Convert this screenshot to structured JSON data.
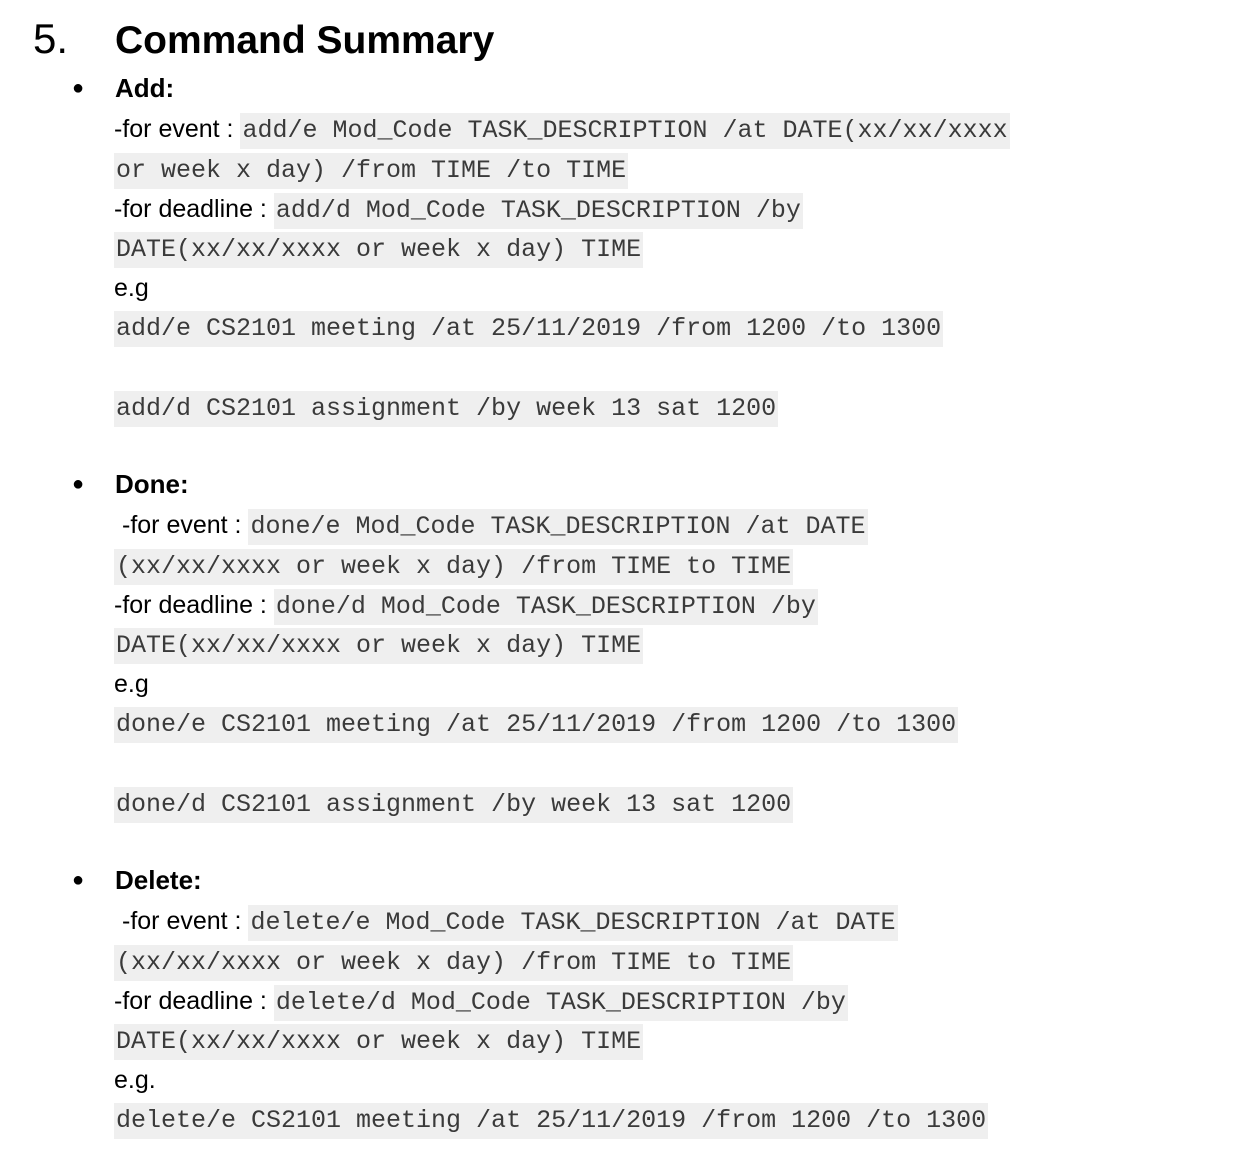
{
  "heading": {
    "number": "5.",
    "title": "Command Summary"
  },
  "sections": [
    {
      "title": "Add:",
      "event_label": "-for event : ",
      "event_code_1": "add/e Mod_Code TASK_DESCRIPTION /at DATE(xx/xx/xxxx",
      "event_code_2": "or week x day) /from TIME /to TIME",
      "deadline_label": "-for deadline : ",
      "deadline_code_1": "add/d Mod_Code TASK_DESCRIPTION /by",
      "deadline_code_2": "DATE(xx/xx/xxxx or week x day) TIME",
      "eg_label": "e.g",
      "example_1": "add/e CS2101 meeting /at 25/11/2019 /from 1200 /to 1300",
      "example_2": "add/d CS2101 assignment /by week 13 sat 1200"
    },
    {
      "title": "Done:",
      "event_label": "-for event : ",
      "event_code_1": "done/e Mod_Code TASK_DESCRIPTION /at DATE",
      "event_code_2": "(xx/xx/xxxx or week x day) /from TIME to TIME",
      "deadline_label": "-for deadline : ",
      "deadline_code_1": "done/d Mod_Code TASK_DESCRIPTION /by",
      "deadline_code_2": "DATE(xx/xx/xxxx or week x day) TIME",
      "eg_label": "e.g",
      "example_1": "done/e CS2101 meeting /at 25/11/2019 /from 1200 /to 1300",
      "example_2": "done/d CS2101 assignment /by week 13 sat 1200"
    },
    {
      "title": "Delete:",
      "event_label": "-for event : ",
      "event_code_1": "delete/e Mod_Code TASK_DESCRIPTION /at DATE",
      "event_code_2": "(xx/xx/xxxx or week x day) /from TIME to TIME",
      "deadline_label": "-for deadline : ",
      "deadline_code_1": "delete/d Mod_Code TASK_DESCRIPTION /by",
      "deadline_code_2": "DATE(xx/xx/xxxx or week x day) TIME",
      "eg_label": "e.g.",
      "example_1": "delete/e CS2101 meeting /at 25/11/2019 /from 1200 /to 1300"
    }
  ]
}
